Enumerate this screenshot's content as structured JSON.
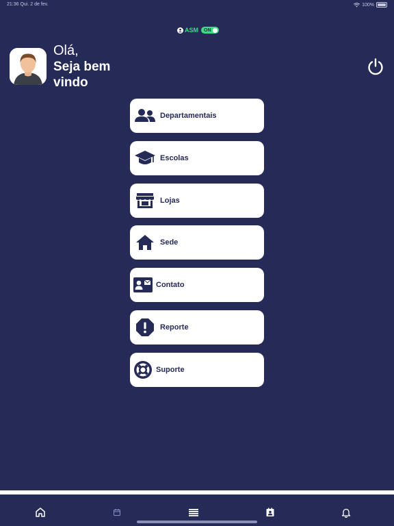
{
  "status": {
    "left": "21:36  Qui. 2 de fev.",
    "right": "100%"
  },
  "brand": {
    "name": "ASM",
    "toggle": "ON"
  },
  "greeting": {
    "hello": "Olá,",
    "welcome": "Seja bem vindo"
  },
  "menu": {
    "items": [
      {
        "label": "Departamentais",
        "icon": "users-icon"
      },
      {
        "label": "Escolas",
        "icon": "graduation-cap-icon"
      },
      {
        "label": "Lojas",
        "icon": "store-icon"
      },
      {
        "label": "Sede",
        "icon": "house-icon"
      },
      {
        "label": "Contato",
        "icon": "contact-card-icon"
      },
      {
        "label": "Reporte",
        "icon": "alert-octagon-icon"
      },
      {
        "label": "Suporte",
        "icon": "lifebuoy-icon"
      }
    ]
  },
  "tabs": [
    {
      "icon": "home-icon"
    },
    {
      "icon": "calendar-icon"
    },
    {
      "icon": "list-icon"
    },
    {
      "icon": "contact-book-icon"
    },
    {
      "icon": "bell-icon"
    }
  ],
  "colors": {
    "background": "#252a57",
    "card": "#ffffff",
    "accent": "#3ddc84",
    "text_dark": "#252a57"
  }
}
